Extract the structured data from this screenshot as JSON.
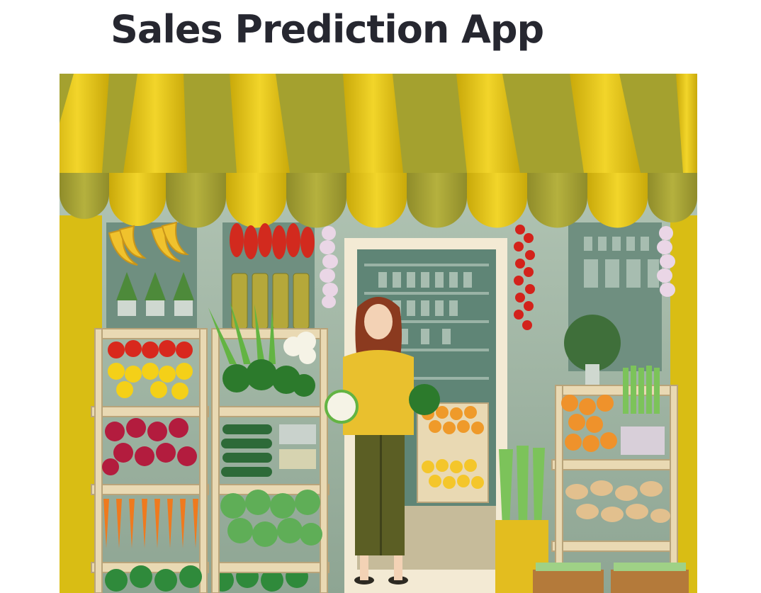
{
  "app": {
    "title": "Sales Prediction App"
  },
  "hero_image": {
    "description_icon": "grocery-storefront-illustration",
    "colors": {
      "awning_yellow": "#e6c515",
      "awning_olive": "#a4a12f",
      "wall_green": "#9fb7a3",
      "wood": "#e9d9b3"
    }
  }
}
